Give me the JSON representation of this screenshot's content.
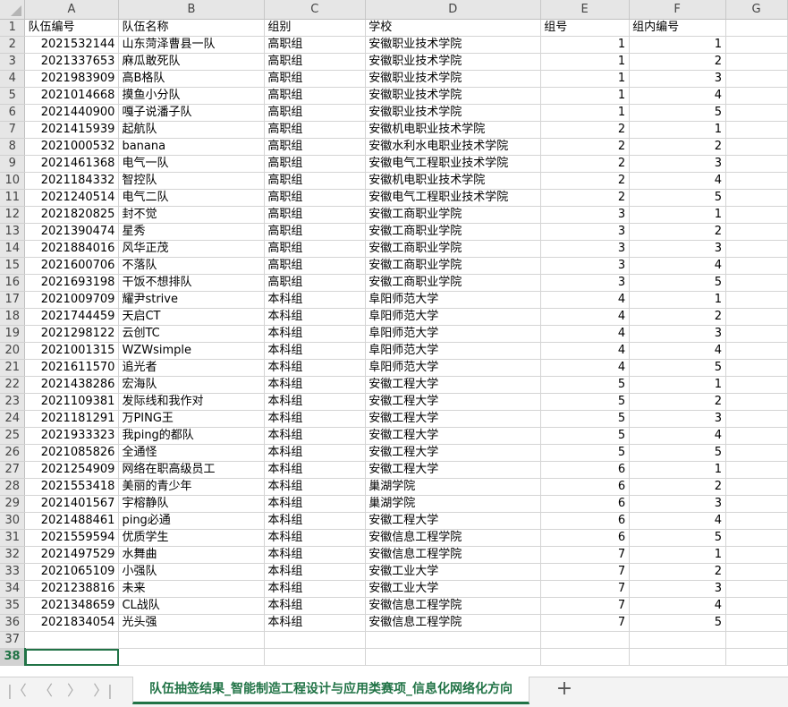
{
  "columns": [
    "A",
    "B",
    "C",
    "D",
    "E",
    "F",
    "G"
  ],
  "header_row": [
    "队伍编号",
    "队伍名称",
    "组别",
    "学校",
    "组号",
    "组内编号",
    ""
  ],
  "rows": [
    [
      "2021532144",
      "山东菏泽曹县一队",
      "高职组",
      "安徽职业技术学院",
      "1",
      "1"
    ],
    [
      "2021337653",
      "麻瓜敢死队",
      "高职组",
      "安徽职业技术学院",
      "1",
      "2"
    ],
    [
      "2021983909",
      "高B格队",
      "高职组",
      "安徽职业技术学院",
      "1",
      "3"
    ],
    [
      "2021014668",
      "摸鱼小分队",
      "高职组",
      "安徽职业技术学院",
      "1",
      "4"
    ],
    [
      "2021440900",
      "嘎子说潘子队",
      "高职组",
      "安徽职业技术学院",
      "1",
      "5"
    ],
    [
      "2021415939",
      "起航队",
      "高职组",
      "安徽机电职业技术学院",
      "2",
      "1"
    ],
    [
      "2021000532",
      "banana",
      "高职组",
      "安徽水利水电职业技术学院",
      "2",
      "2"
    ],
    [
      "2021461368",
      "电气一队",
      "高职组",
      "安徽电气工程职业技术学院",
      "2",
      "3"
    ],
    [
      "2021184332",
      "智控队",
      "高职组",
      "安徽机电职业技术学院",
      "2",
      "4"
    ],
    [
      "2021240514",
      "电气二队",
      "高职组",
      "安徽电气工程职业技术学院",
      "2",
      "5"
    ],
    [
      "2021820825",
      "封不觉",
      "高职组",
      "安徽工商职业学院",
      "3",
      "1"
    ],
    [
      "2021390474",
      "星秀",
      "高职组",
      "安徽工商职业学院",
      "3",
      "2"
    ],
    [
      "2021884016",
      "风华正茂",
      "高职组",
      "安徽工商职业学院",
      "3",
      "3"
    ],
    [
      "2021600706",
      "不落队",
      "高职组",
      "安徽工商职业学院",
      "3",
      "4"
    ],
    [
      "2021693198",
      "干饭不想排队",
      "高职组",
      "安徽工商职业学院",
      "3",
      "5"
    ],
    [
      "2021009709",
      "耀尹strive",
      "本科组",
      "阜阳师范大学",
      "4",
      "1"
    ],
    [
      "2021744459",
      "天启CT",
      "本科组",
      "阜阳师范大学",
      "4",
      "2"
    ],
    [
      "2021298122",
      "云创TC",
      "本科组",
      "阜阳师范大学",
      "4",
      "3"
    ],
    [
      "2021001315",
      "WZWsimple",
      "本科组",
      "阜阳师范大学",
      "4",
      "4"
    ],
    [
      "2021611570",
      "追光者",
      "本科组",
      "阜阳师范大学",
      "4",
      "5"
    ],
    [
      "2021438286",
      "宏海队",
      "本科组",
      "安徽工程大学",
      "5",
      "1"
    ],
    [
      "2021109381",
      "发际线和我作对",
      "本科组",
      "安徽工程大学",
      "5",
      "2"
    ],
    [
      "2021181291",
      "万PING王",
      "本科组",
      "安徽工程大学",
      "5",
      "3"
    ],
    [
      "2021933323",
      "我ping的都队",
      "本科组",
      "安徽工程大学",
      "5",
      "4"
    ],
    [
      "2021085826",
      "全通怪",
      "本科组",
      "安徽工程大学",
      "5",
      "5"
    ],
    [
      "2021254909",
      "网络在职高级员工",
      "本科组",
      "安徽工程大学",
      "6",
      "1"
    ],
    [
      "2021553418",
      "美丽的青少年",
      "本科组",
      "巢湖学院",
      "6",
      "2"
    ],
    [
      "2021401567",
      "宇榕静队",
      "本科组",
      "巢湖学院",
      "6",
      "3"
    ],
    [
      "2021488461",
      "ping必通",
      "本科组",
      "安徽工程大学",
      "6",
      "4"
    ],
    [
      "2021559594",
      "优质学生",
      "本科组",
      "安徽信息工程学院",
      "6",
      "5"
    ],
    [
      "2021497529",
      "水舞曲",
      "本科组",
      "安徽信息工程学院",
      "7",
      "1"
    ],
    [
      "2021065109",
      "小强队",
      "本科组",
      "安徽工业大学",
      "7",
      "2"
    ],
    [
      "2021238816",
      "未来",
      "本科组",
      "安徽工业大学",
      "7",
      "3"
    ],
    [
      "2021348659",
      "CL战队",
      "本科组",
      "安徽信息工程学院",
      "7",
      "4"
    ],
    [
      "2021834054",
      "光头强",
      "本科组",
      "安徽信息工程学院",
      "7",
      "5"
    ]
  ],
  "row_numbers": [
    "1",
    "2",
    "3",
    "4",
    "5",
    "6",
    "7",
    "8",
    "9",
    "10",
    "11",
    "12",
    "13",
    "14",
    "15",
    "16",
    "17",
    "18",
    "19",
    "20",
    "21",
    "22",
    "23",
    "24",
    "25",
    "26",
    "27",
    "28",
    "29",
    "30",
    "31",
    "32",
    "33",
    "34",
    "35",
    "36",
    "37",
    "38"
  ],
  "selected_row": "38",
  "sheet_tab": {
    "label": "队伍抽签结果_智能制造工程设计与应用类赛项_信息化网络化方向"
  },
  "nav_icons": [
    "first-sheet-icon",
    "prev-sheet-icon",
    "next-sheet-icon",
    "last-sheet-icon"
  ],
  "nav_glyphs": [
    "|〈",
    "〈",
    "〉",
    "〉|"
  ],
  "add_sheet_glyph": "+",
  "accent_color": "#217346"
}
